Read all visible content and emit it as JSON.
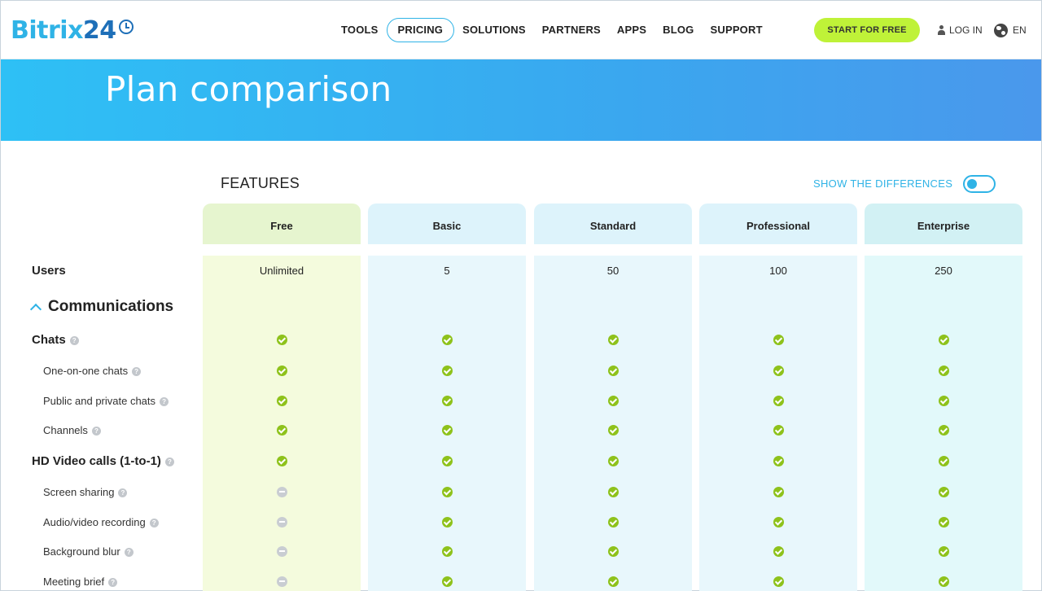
{
  "header": {
    "logo_text": "Bitrix",
    "logo_num": "24",
    "nav": [
      "TOOLS",
      "PRICING",
      "SOLUTIONS",
      "PARTNERS",
      "APPS",
      "BLOG",
      "SUPPORT"
    ],
    "active_nav": "PRICING",
    "cta": "START FOR FREE",
    "login": "LOG IN",
    "lang": "EN"
  },
  "hero": {
    "title": "Plan comparison"
  },
  "toolbar": {
    "features_label": "FEATURES",
    "differences_label": "SHOW THE DIFFERENCES",
    "differences_on": false
  },
  "plans": [
    "Free",
    "Basic",
    "Standard",
    "Professional",
    "Enterprise"
  ],
  "users_row": {
    "label": "Users",
    "values": [
      "Unlimited",
      "5",
      "50",
      "100",
      "250"
    ]
  },
  "section": {
    "title": "Communications",
    "expanded": true
  },
  "features": [
    {
      "label": "Chats",
      "level": "main",
      "values": [
        "check",
        "check",
        "check",
        "check",
        "check"
      ]
    },
    {
      "label": "One-on-one chats",
      "level": "sub",
      "values": [
        "check",
        "check",
        "check",
        "check",
        "check"
      ]
    },
    {
      "label": "Public and private chats",
      "level": "sub",
      "values": [
        "check",
        "check",
        "check",
        "check",
        "check"
      ]
    },
    {
      "label": "Channels",
      "level": "sub",
      "values": [
        "check",
        "check",
        "check",
        "check",
        "check"
      ]
    },
    {
      "label": "HD Video calls (1-to-1)",
      "level": "main",
      "values": [
        "check",
        "check",
        "check",
        "check",
        "check"
      ]
    },
    {
      "label": "Screen sharing",
      "level": "sub",
      "values": [
        "dash",
        "check",
        "check",
        "check",
        "check"
      ]
    },
    {
      "label": "Audio/video recording",
      "level": "sub",
      "values": [
        "dash",
        "check",
        "check",
        "check",
        "check"
      ]
    },
    {
      "label": "Background blur",
      "level": "sub",
      "values": [
        "dash",
        "check",
        "check",
        "check",
        "check"
      ]
    },
    {
      "label": "Meeting brief",
      "level": "sub",
      "values": [
        "dash",
        "check",
        "check",
        "check",
        "check"
      ]
    }
  ],
  "colors": {
    "accent": "#2fb3e6",
    "cta": "#bff238",
    "check": "#8ec21b",
    "dash": "#c9cdd2"
  }
}
